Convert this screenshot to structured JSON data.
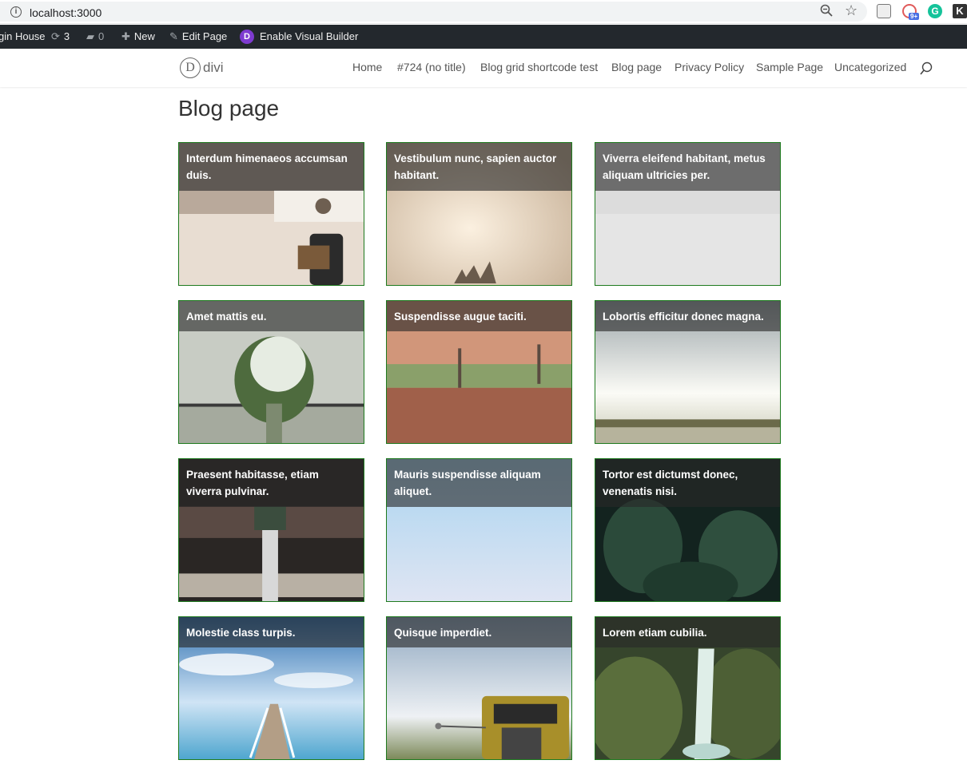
{
  "browser": {
    "url": "localhost:3000",
    "ext_badge": "9+",
    "ext_grammarly": "G",
    "ext_k": "K"
  },
  "admin_bar": {
    "site_name": "gin House",
    "updates_count": "3",
    "comments_count": "0",
    "new_label": "New",
    "edit_label": "Edit Page",
    "divi_letter": "D",
    "visual_builder_label": "Enable Visual Builder"
  },
  "header": {
    "logo_letter": "D",
    "logo_text": "divi",
    "nav": [
      "Home",
      "#724 (no title)",
      "Blog grid shortcode test",
      "Blog page",
      "Privacy Policy",
      "Sample Page",
      "Uncategorized"
    ]
  },
  "page": {
    "title": "Blog page"
  },
  "posts": [
    {
      "title": "Interdum himenaeos accumsan duis."
    },
    {
      "title": "Vestibulum nunc, sapien auctor habitant."
    },
    {
      "title": "Viverra eleifend habitant, metus aliquam ultricies per."
    },
    {
      "title": "Amet mattis eu."
    },
    {
      "title": "Suspendisse augue taciti."
    },
    {
      "title": "Lobortis efficitur donec magna."
    },
    {
      "title": "Praesent habitasse, etiam viverra pulvinar."
    },
    {
      "title": "Mauris suspendisse aliquam aliquet."
    },
    {
      "title": "Tortor est dictumst donec, venenatis nisi."
    },
    {
      "title": "Molestie class turpis."
    },
    {
      "title": "Quisque imperdiet."
    },
    {
      "title": "Lorem etiam cubilia."
    }
  ],
  "colors": {
    "card_border": "#1e7a1e",
    "admin_bar_bg": "#23282d",
    "divi_purple": "#7e3bd0"
  }
}
